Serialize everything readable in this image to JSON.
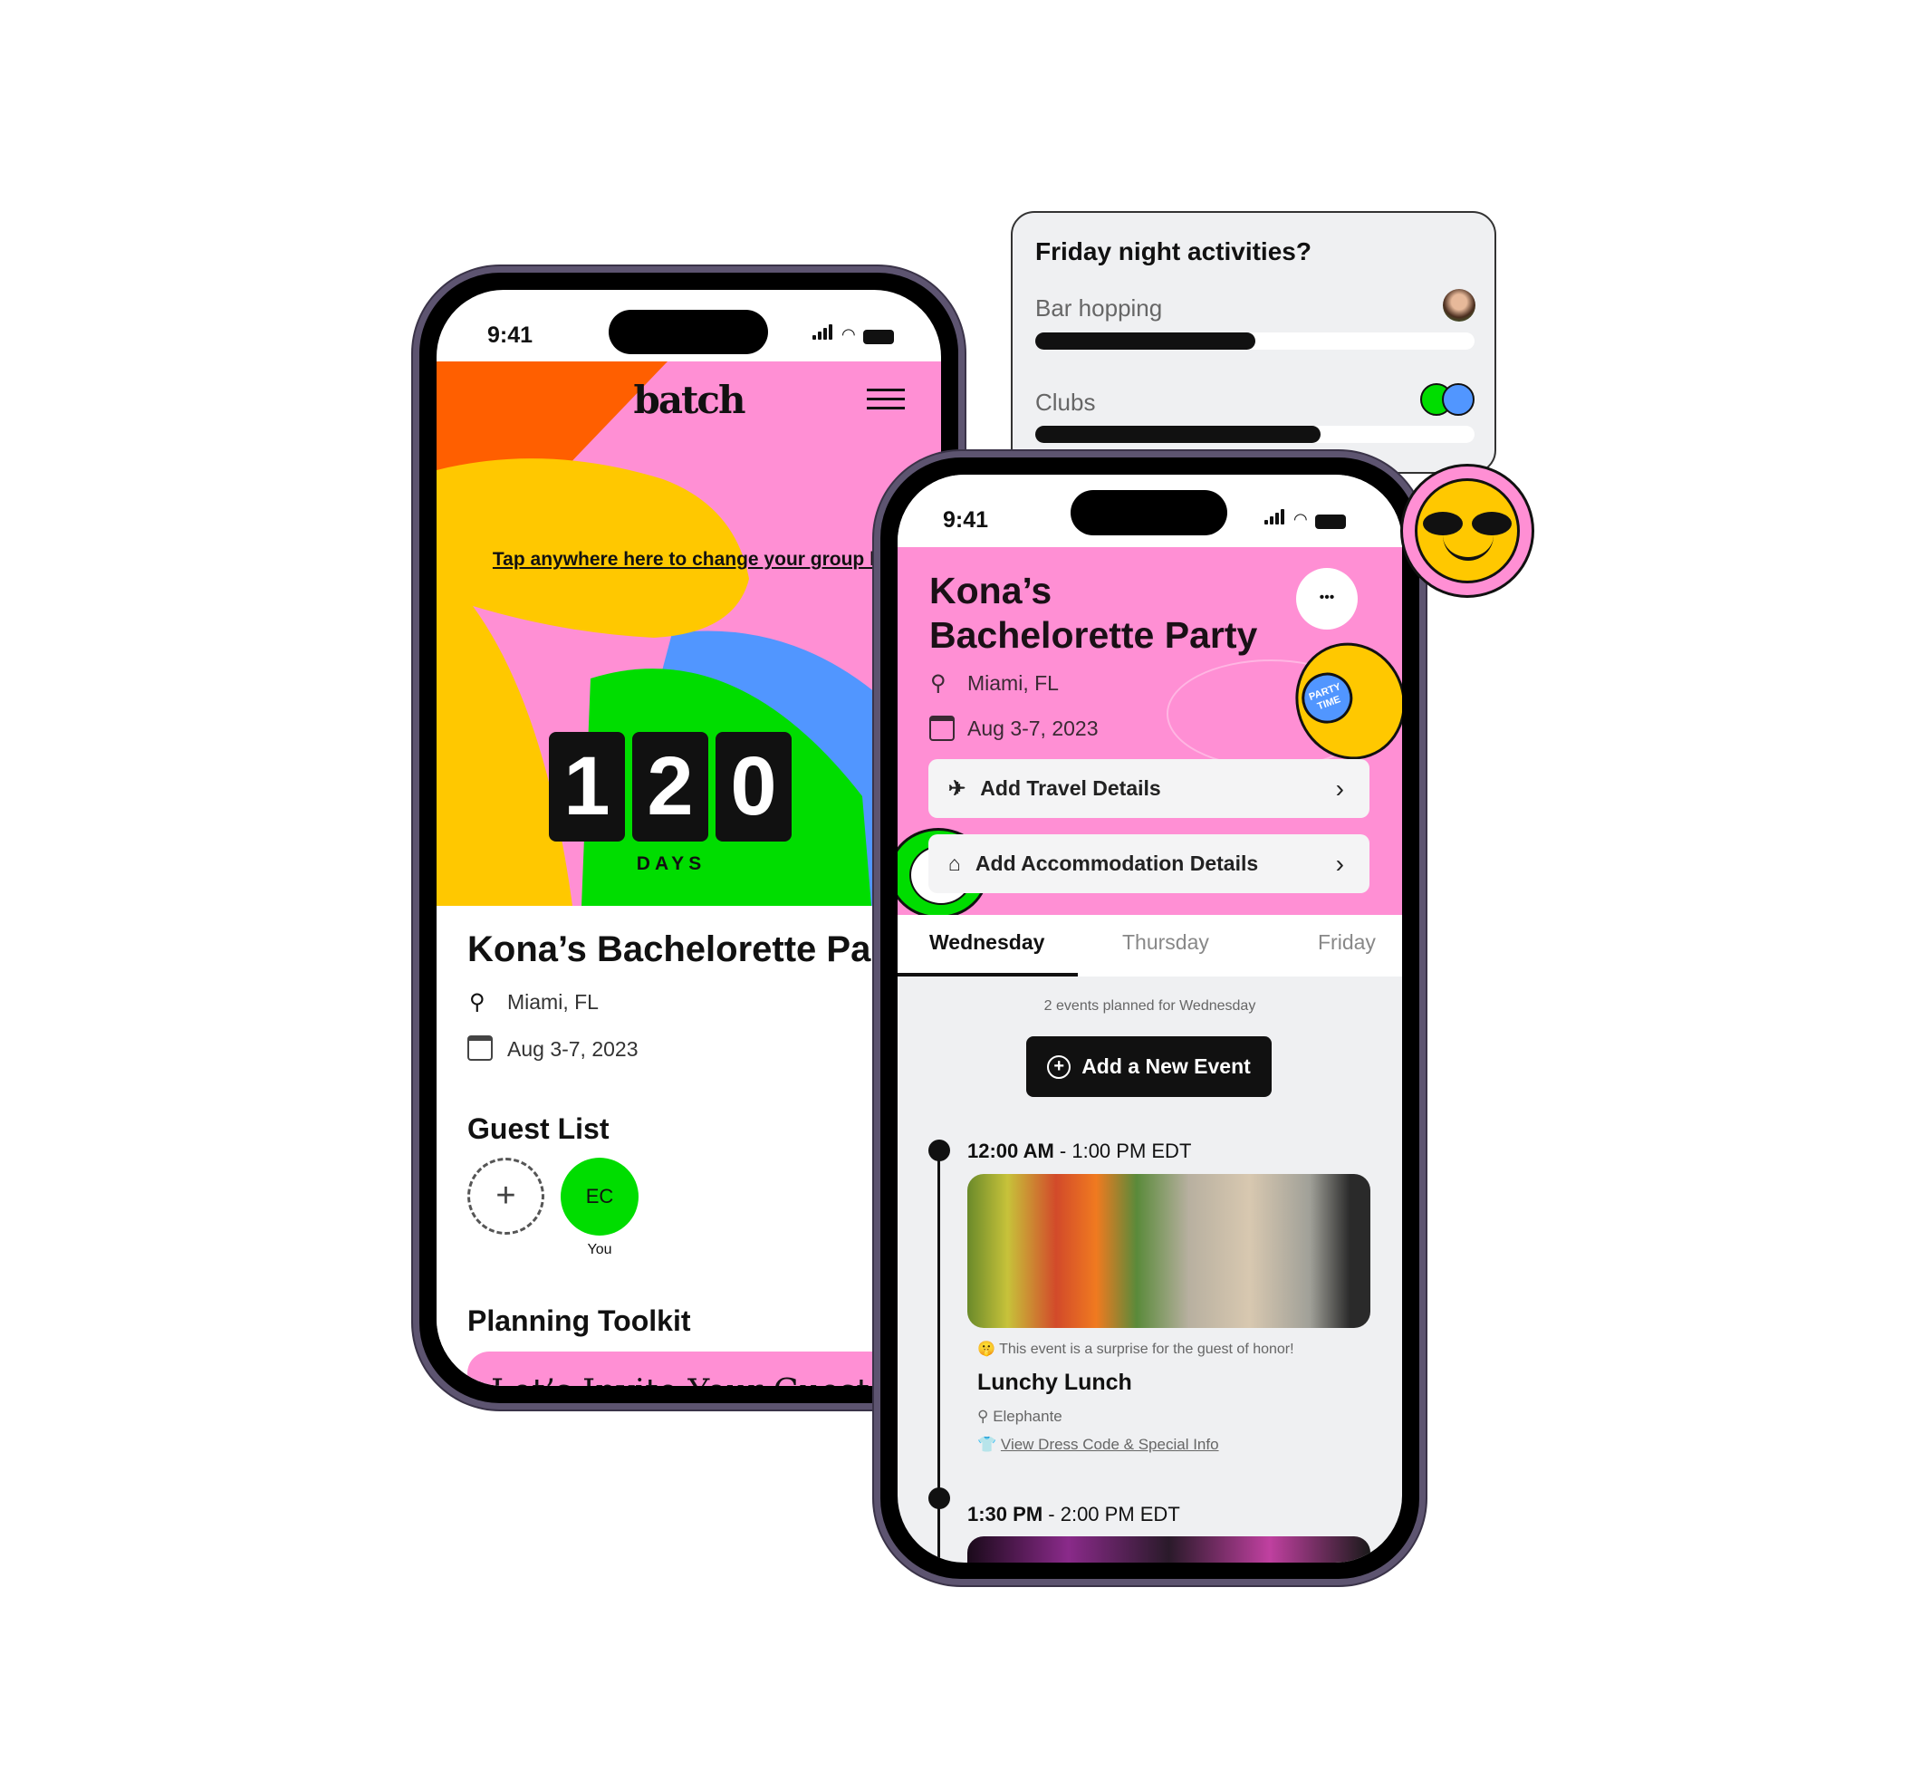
{
  "status_time": "9:41",
  "left_phone": {
    "logo": "batch",
    "header_hint": "Tap anywhere here to change your group header photo!",
    "countdown_digits": [
      "1",
      "2",
      "0"
    ],
    "countdown_unit": "DAYS",
    "title": "Kona’s Bachelorette Party",
    "location": "Miami, FL",
    "dates": "Aug 3-7, 2023",
    "guest_list_heading": "Guest List",
    "guests": [
      {
        "initials": "EC",
        "label": "You",
        "color": "#00dd00"
      }
    ],
    "planning_heading": "Planning Toolkit",
    "planning_card_text": "Let’s Invite Your Guests"
  },
  "poll": {
    "question": "Friday night activities?",
    "options": [
      {
        "label": "Bar hopping",
        "percent": 50
      },
      {
        "label": "Clubs",
        "percent": 65
      }
    ]
  },
  "front_phone": {
    "title": "Kona’s Bachelorette Party",
    "location": "Miami, FL",
    "dates": "Aug 3-7, 2023",
    "more_label": "•••",
    "sticker_text": "PARTY TIME",
    "travel_label": "Add Travel Details",
    "accommodation_label": "Add Accommodation Details",
    "tabs": [
      "Wednesday",
      "Thursday",
      "Friday"
    ],
    "active_tab": "Wednesday",
    "events_summary": "2 events planned for Wednesday",
    "add_event_label": "Add a New Event",
    "events": [
      {
        "start": "12:00 AM",
        "end": "1:00 PM EDT",
        "surprise_note": "This event is a surprise for the guest of honor!",
        "name": "Lunchy Lunch",
        "venue": "Elephante",
        "dress_code_link": "View Dress Code & Special Info"
      },
      {
        "start": "1:30 PM",
        "end": "2:00 PM EDT"
      }
    ]
  },
  "colors": {
    "pink": "#ff8fd4",
    "orange": "#ff5f00",
    "yellow": "#ffc800",
    "blue": "#5196ff",
    "green": "#00dd00"
  }
}
